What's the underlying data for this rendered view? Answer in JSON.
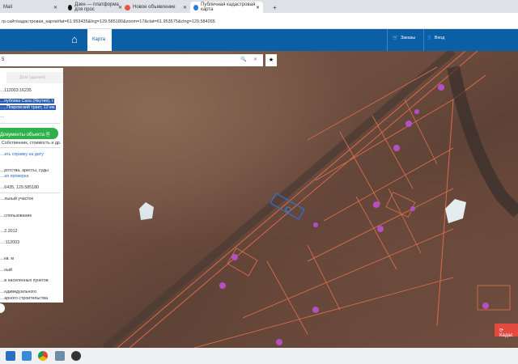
{
  "browser": {
    "tabs": [
      {
        "label": "Mail"
      },
      {
        "label": "Дзен — платформа для прос"
      },
      {
        "label": "Новое объявление"
      },
      {
        "label": "Публичная кадастровая карта"
      }
    ],
    "new_tab": "+",
    "url": "rp.сайт/кадастровая_карта#lat=61.953435&lng=129.585180&zoom=17&clat=61.953575&clng=129.584265"
  },
  "header": {
    "map_tab": "Карта",
    "orders": "Заказы",
    "login": "Вход",
    "accent": "#0b5fa5"
  },
  "search": {
    "value": "5",
    "star": "★"
  },
  "panel": {
    "tab_building": "Дом (здание)",
    "cadastral": "…112003:16235",
    "address_1": "…публика Саха (Якутия), г.",
    "address_2": "…, Покровский тракт, 12 км.",
    "small": "…",
    "docs_button": "Документы объекта",
    "docs_sub": "Собственник, стоимость и др.",
    "report_link": "…ать справку на дату",
    "check_1": "…ротства, аресты, суды",
    "check_2": "…ая проверка",
    "coords": "…6435, 129.585180",
    "rows": [
      "…льный участок",
      "…спользование",
      "…2.2012",
      "…:112003",
      "…кв. м",
      "…ный",
      "…в населенных пунктов",
      "…ндивидуального",
      "…арного строительства"
    ]
  },
  "map_button": "Кадас"
}
